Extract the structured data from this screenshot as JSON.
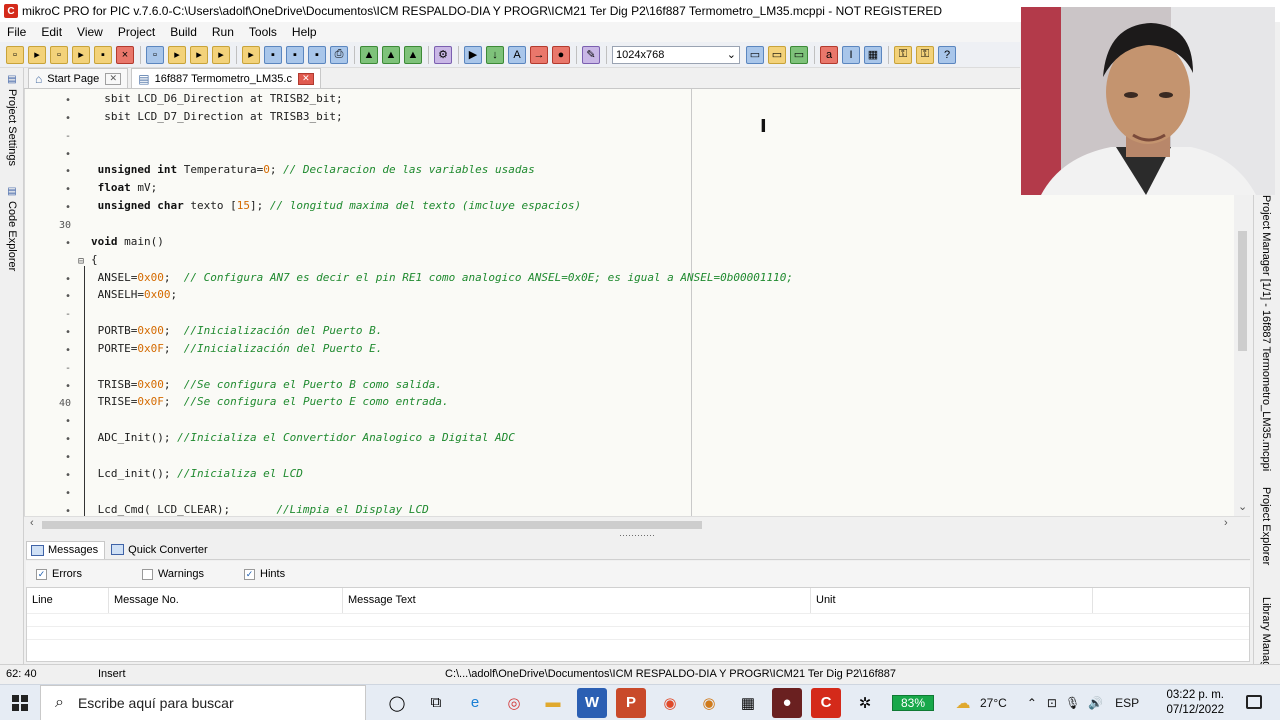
{
  "window": {
    "title": "mikroC PRO for PIC v.7.6.0-C:\\Users\\adolf\\OneDrive\\Documentos\\ICM RESPALDO-DIA Y PROGR\\ICM21 Ter Dig P2\\16f887 Termometro_LM35.mcppi - NOT REGISTERED",
    "app_icon": "C"
  },
  "menu": [
    "File",
    "Edit",
    "View",
    "Project",
    "Build",
    "Run",
    "Tools",
    "Help"
  ],
  "toolbar": {
    "resolution": "1024x768"
  },
  "tabs": [
    {
      "label": "Start Page",
      "close": "✕"
    },
    {
      "label": "16f887 Termometro_LM35.c",
      "close": "✕"
    }
  ],
  "left_panels": [
    "Project Settings",
    "Code Explorer"
  ],
  "right_panels": [
    "Project Manager [1/1] - 16f887 Termometro_LM35.mcppi",
    "Project Explorer",
    "Library Manager"
  ],
  "editor": {
    "gutter": [
      "•",
      "•",
      "-",
      "•",
      "•",
      "•",
      "•",
      "30",
      "•",
      "⊟",
      "•",
      "•",
      "-",
      "•",
      "•",
      "-",
      "•",
      "40",
      "•",
      "•",
      "•",
      "•",
      "•",
      "•"
    ],
    "lines": [
      [
        {
          "t": "  sbit LCD_D6_Direction at TRISB2_bit;",
          "c": ""
        }
      ],
      [
        {
          "t": "  sbit LCD_D7_Direction at TRISB3_bit;",
          "c": ""
        }
      ],
      [],
      [],
      [
        {
          "t": " unsigned int",
          "c": "kw"
        },
        {
          "t": " Temperatura=",
          "c": ""
        },
        {
          "t": "0",
          "c": "num"
        },
        {
          "t": "; ",
          "c": ""
        },
        {
          "t": "// Declaracion de las variables usadas",
          "c": "cmt"
        }
      ],
      [
        {
          "t": " float",
          "c": "kw"
        },
        {
          "t": " mV;",
          "c": ""
        }
      ],
      [
        {
          "t": " unsigned char",
          "c": "kw"
        },
        {
          "t": " texto [",
          "c": ""
        },
        {
          "t": "15",
          "c": "num"
        },
        {
          "t": "]; ",
          "c": ""
        },
        {
          "t": "// longitud maxima del texto (imcluye espacios)",
          "c": "cmt"
        }
      ],
      [],
      [
        {
          "t": "void",
          "c": "kw"
        },
        {
          "t": " main()",
          "c": ""
        }
      ],
      [
        {
          "t": "{",
          "c": ""
        }
      ],
      [
        {
          "t": " ANSEL=",
          "c": ""
        },
        {
          "t": "0x00",
          "c": "num"
        },
        {
          "t": ";  ",
          "c": ""
        },
        {
          "t": "// Configura AN7 es decir el pin RE1 como analogico ANSEL=0x0E; es igual a ANSEL=0b00001110;",
          "c": "cmt"
        }
      ],
      [
        {
          "t": " ANSELH=",
          "c": ""
        },
        {
          "t": "0x00",
          "c": "num"
        },
        {
          "t": ";",
          "c": ""
        }
      ],
      [],
      [
        {
          "t": " PORTB=",
          "c": ""
        },
        {
          "t": "0x00",
          "c": "num"
        },
        {
          "t": ";  ",
          "c": ""
        },
        {
          "t": "//Inicialización del Puerto B.",
          "c": "cmt"
        }
      ],
      [
        {
          "t": " PORTE=",
          "c": ""
        },
        {
          "t": "0x0F",
          "c": "num"
        },
        {
          "t": ";  ",
          "c": ""
        },
        {
          "t": "//Inicialización del Puerto E.",
          "c": "cmt"
        }
      ],
      [],
      [
        {
          "t": " TRISB=",
          "c": ""
        },
        {
          "t": "0x00",
          "c": "num"
        },
        {
          "t": ";  ",
          "c": ""
        },
        {
          "t": "//Se configura el Puerto B como salida.",
          "c": "cmt"
        }
      ],
      [
        {
          "t": " TRISE=",
          "c": ""
        },
        {
          "t": "0x0F",
          "c": "num"
        },
        {
          "t": ";  ",
          "c": ""
        },
        {
          "t": "//Se configura el Puerto E como entrada.",
          "c": "cmt"
        }
      ],
      [],
      [
        {
          "t": " ADC_Init(); ",
          "c": ""
        },
        {
          "t": "//Inicializa el Convertidor Analogico a Digital ADC",
          "c": "cmt"
        }
      ],
      [],
      [
        {
          "t": " Lcd_init(); ",
          "c": ""
        },
        {
          "t": "//Inicializa el LCD",
          "c": "cmt"
        }
      ],
      [],
      [
        {
          "t": " Lcd_Cmd( LCD_CLEAR);       ",
          "c": ""
        },
        {
          "t": "//Limpia el Display LCD",
          "c": "cmt"
        }
      ]
    ]
  },
  "messages": {
    "tabs": [
      "Messages",
      "Quick Converter"
    ],
    "filters": [
      {
        "label": "Errors",
        "checked": true
      },
      {
        "label": "Warnings",
        "checked": false
      },
      {
        "label": "Hints",
        "checked": true
      }
    ],
    "columns": [
      "Line",
      "Message No.",
      "Message Text",
      "Unit"
    ]
  },
  "status": {
    "position": "62: 40",
    "mode": "Insert",
    "path": "C:\\...\\adolf\\OneDrive\\Documentos\\ICM RESPALDO-DIA Y PROGR\\ICM21 Ter Dig P2\\16f887"
  },
  "taskbar": {
    "search_placeholder": "Escribe aquí para buscar",
    "battery": "83%",
    "weather": "27°C",
    "lang": "ESP",
    "time": "03:22 p. m.",
    "date": "07/12/2022"
  }
}
